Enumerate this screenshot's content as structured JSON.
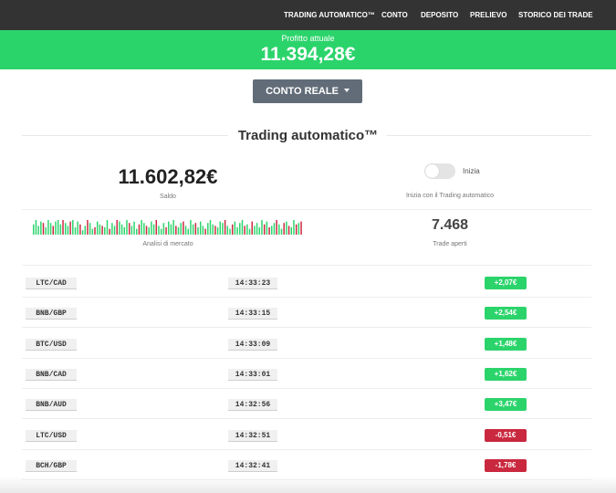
{
  "nav": {
    "items": [
      "TRADING AUTOMATICO™",
      "CONTO",
      "DEPOSITO",
      "PRELIEVO",
      "STORICO DEI TRADE"
    ]
  },
  "profit": {
    "label": "Profitto attuale",
    "value": "11.394,28€"
  },
  "account_button": {
    "label": "CONTO REALE"
  },
  "section": {
    "title": "Trading automatico™"
  },
  "balance": {
    "value": "11.602,82€",
    "label": "Saldo"
  },
  "auto_trading": {
    "toggle_label": "Inizia",
    "caption": "Inizia con il Trading automatico",
    "enabled": false
  },
  "market": {
    "label": "Analisi di mercato",
    "bars": [
      0.7,
      1,
      0.6,
      0.9,
      -0.8,
      0.5,
      1,
      0.8,
      -0.6,
      0.9,
      1,
      0.7,
      -1,
      0.8,
      0.6,
      -0.9,
      1,
      0.5,
      0.9,
      -0.7,
      0.3,
      0.6,
      -1,
      0.8,
      0.4,
      -0.5,
      0.9,
      0.7,
      -0.6,
      0.5,
      1,
      -0.4,
      0.8,
      0.6,
      -1,
      0.9,
      0.7,
      0.5,
      1,
      -0.8,
      0.6,
      0.9,
      0.4,
      -0.7,
      1,
      0.8,
      -0.6,
      0.5,
      0.9,
      0.7,
      -1,
      0.6,
      0.4,
      0.8,
      -0.5,
      0.9,
      0.7,
      1,
      -0.6,
      0.5,
      0.8,
      -0.9,
      0.6,
      0.4,
      1,
      0.7,
      -0.8,
      0.5,
      0.9,
      0.6,
      -0.4,
      0.8,
      1,
      0.7,
      -0.6,
      0.5,
      0.9,
      0.8,
      -1,
      0.6,
      0.4,
      -0.7,
      0.9,
      0.5,
      0.8,
      1,
      -0.6,
      0.7,
      0.4,
      -0.9,
      0.6,
      0.8,
      0.5,
      1,
      -0.7,
      0.9,
      -0.5,
      0.6,
      0.8,
      -1,
      0.7,
      0.4,
      -0.8,
      0.9,
      -0.6,
      0.5,
      1,
      -0.7,
      0.8,
      -0.9
    ]
  },
  "trades": {
    "open_count": "7.468",
    "label": "Trade aperti",
    "rows": [
      {
        "pair": "LTC/CAD",
        "time": "14:33:23",
        "amount": "+2,07€",
        "direction": "pos"
      },
      {
        "pair": "BNB/GBP",
        "time": "14:33:15",
        "amount": "+2,54€",
        "direction": "pos"
      },
      {
        "pair": "BTC/USD",
        "time": "14:33:09",
        "amount": "+1,48€",
        "direction": "pos"
      },
      {
        "pair": "BNB/CAD",
        "time": "14:33:01",
        "amount": "+1,62€",
        "direction": "pos"
      },
      {
        "pair": "BNB/AUD",
        "time": "14:32:56",
        "amount": "+3,47€",
        "direction": "pos"
      },
      {
        "pair": "LTC/USD",
        "time": "14:32:51",
        "amount": "-0,51€",
        "direction": "neg"
      },
      {
        "pair": "BCH/GBP",
        "time": "14:32:41",
        "amount": "-1,78€",
        "direction": "neg"
      }
    ]
  },
  "colors": {
    "nav_bg": "#333333",
    "profit_bg": "#2bd46b",
    "button_bg": "#616c78",
    "positive": "#2bd46b",
    "negative": "#c9283e"
  }
}
